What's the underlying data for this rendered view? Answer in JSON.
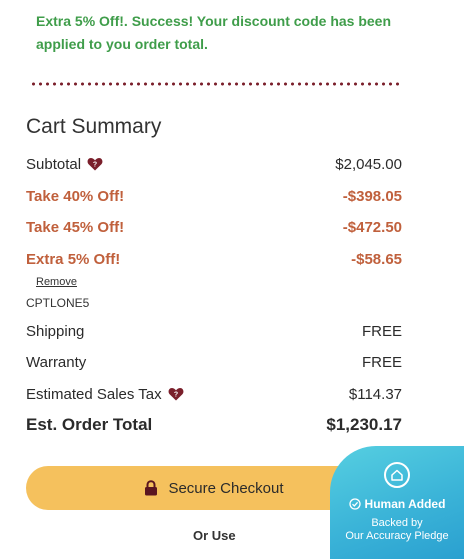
{
  "success_message": "Extra 5% Off!. Success! Your discount code has been applied to you order total.",
  "cart_summary": {
    "title": "Cart Summary",
    "subtotal": {
      "label": "Subtotal",
      "value": "$2,045.00"
    },
    "discounts": [
      {
        "label": "Take 40% Off!",
        "value": "-$398.05"
      },
      {
        "label": "Take 45% Off!",
        "value": "-$472.50"
      },
      {
        "label": "Extra 5% Off!",
        "value": "-$58.65"
      }
    ],
    "remove_label": "Remove",
    "promo_code": "CPTLONE5",
    "shipping": {
      "label": "Shipping",
      "value": "FREE"
    },
    "warranty": {
      "label": "Warranty",
      "value": "FREE"
    },
    "tax": {
      "label": "Estimated Sales Tax",
      "value": "$114.37"
    },
    "total": {
      "label": "Est. Order Total",
      "value": "$1,230.17"
    }
  },
  "checkout": {
    "label": "Secure Checkout",
    "icon": "lock-icon"
  },
  "or_use": "Or Use",
  "badge": {
    "headline": "Human Added",
    "subtext_line1": "Backed by",
    "subtext_line2": "Our Accuracy Pledge",
    "icon": "house-icon"
  },
  "colors": {
    "success_green": "#3f9d4a",
    "discount_orange": "#c0603c",
    "accent_maroon": "#7a1f2b",
    "checkout_yellow": "#f5c15d",
    "badge_teal": "#3bb4d8"
  }
}
